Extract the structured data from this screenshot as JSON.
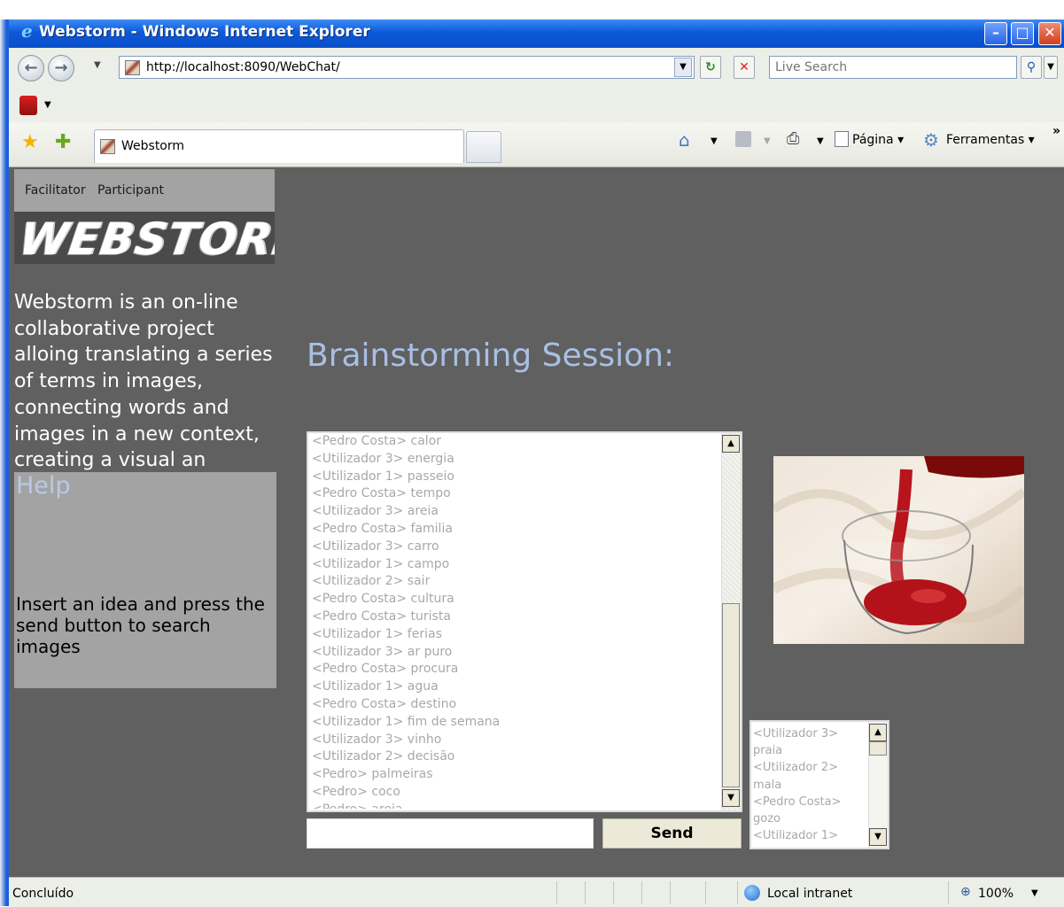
{
  "window": {
    "title": "Webstorm - Windows Internet Explorer"
  },
  "address_bar": {
    "url": "http://localhost:8090/WebChat/"
  },
  "search": {
    "placeholder": "Live Search"
  },
  "tab": {
    "label": "Webstorm"
  },
  "toolbar": {
    "pagina": "Página ▾",
    "ferramentas": "Ferramentas ▾",
    "overflow": "»"
  },
  "page": {
    "menu": {
      "facilitator": "Facilitator",
      "participant": "Participant"
    },
    "logo_text": "WEBSTORM",
    "intro": "Webstorm is an on-line collaborative project alloing translating a series of terms in images, connecting words and images in a new context, creating a visual an interactive work.",
    "help": {
      "title": "Help",
      "text": "Insert an idea and press the send button to search images"
    },
    "session_title": "Brainstorming Session:",
    "chat_lines": [
      "<Pedro Costa> calor",
      "<Utilizador 3> energia",
      "<Utilizador 1> passeio",
      "<Pedro Costa> tempo",
      "<Utilizador 3> areia",
      "<Pedro Costa> familia",
      "<Utilizador 3> carro",
      "<Utilizador 1> campo",
      "<Utilizador 2> sair",
      "<Pedro Costa> cultura",
      "<Pedro Costa> turista",
      "<Utilizador 1> ferias",
      "<Utilizador 3> ar puro",
      "<Pedro Costa> procura",
      "<Utilizador 1> agua",
      "<Pedro Costa> destino",
      "<Utilizador 1> fim de semana",
      "<Utilizador 3> vinho",
      "<Utilizador 2> decisão",
      "<Pedro> palmeiras",
      "<Pedro> coco",
      "<Pedro> areia"
    ],
    "message_value": "",
    "send_label": "Send",
    "ideas": [
      "<Utilizador 3>",
      "praia",
      "<Utilizador 2>",
      "mala",
      "<Pedro Costa>",
      "gozo",
      "<Utilizador 1>"
    ]
  },
  "status": {
    "text": "Concluído",
    "zone": "Local intranet",
    "zoom": "100%"
  },
  "colors": {
    "page_bg": "#606060",
    "panel_bg": "#a3a3a3",
    "title_accent": "#a9bfe4",
    "titlebar": "#0c5ad8"
  },
  "icons": [
    "ie-logo-icon",
    "back-icon",
    "forward-icon",
    "refresh-icon",
    "stop-icon",
    "search-icon",
    "favorites-star-icon",
    "add-favorite-icon",
    "home-icon",
    "rss-icon",
    "print-icon",
    "page-icon",
    "tools-gear-icon",
    "globe-icon",
    "zoom-icon"
  ]
}
